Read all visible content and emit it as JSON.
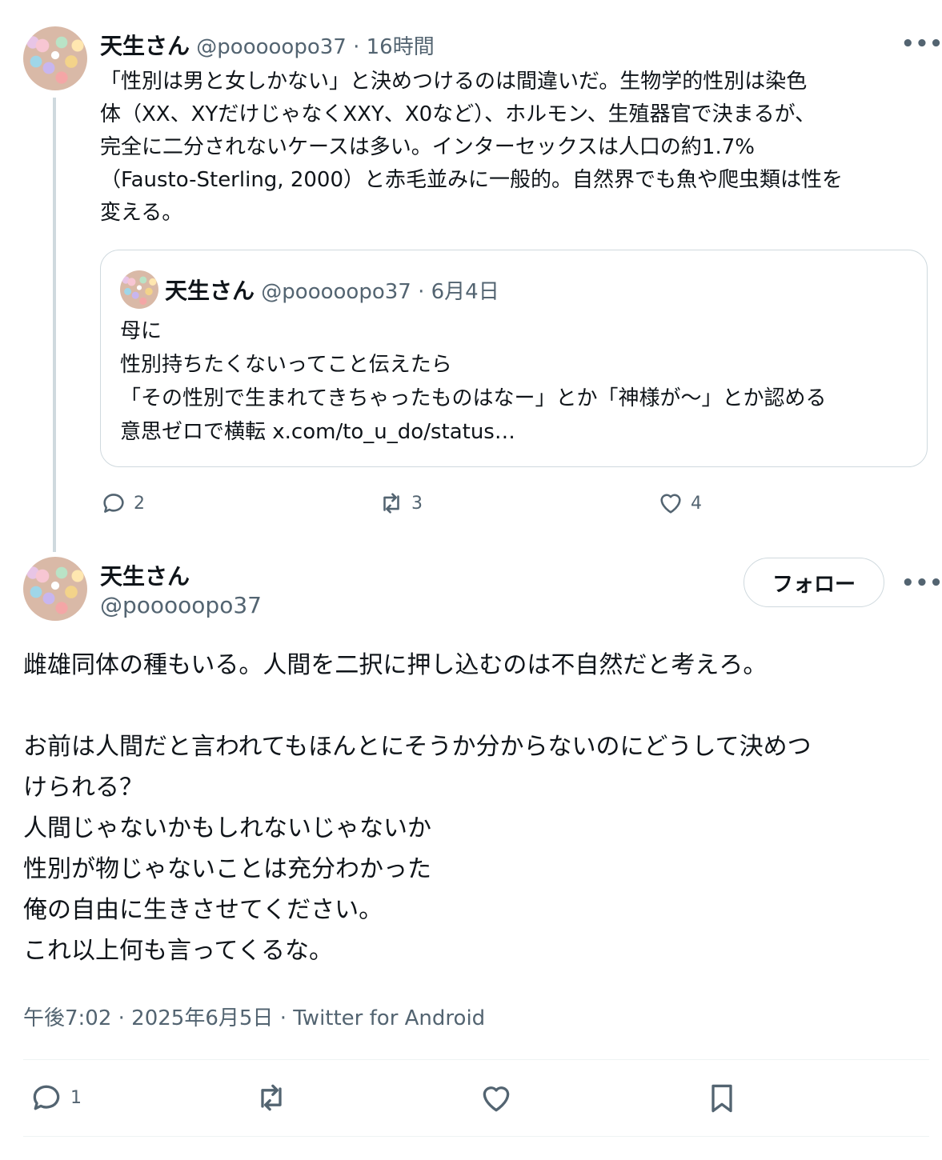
{
  "reply_tweet": {
    "display_name": "天生さん",
    "handle": "@pooooopo37",
    "time": "16時間",
    "more_icon": "more-horizontal-icon",
    "text_lines": [
      "「性別は男と女しかない」と決めつけるのは間違いだ。生物学的性別は染色",
      "体（XX、XYだけじゃなくXXY、X0など）、ホルモン、生殖器官で決まるが、",
      "完全に二分されないケースは多い。インターセックスは人口の約1.7%",
      "（Fausto-Sterling, 2000）と赤毛並みに一般的。自然界でも魚や爬虫類は性を",
      "変える。"
    ],
    "quote": {
      "display_name": "天生さん",
      "handle": "@pooooopo37",
      "date": "6月4日",
      "text_lines": [
        "母に",
        "性別持ちたくないってこと伝えたら",
        "「その性別で生まれてきちゃったものはなー」とか「神様が〜」とか認める",
        "意思ゼロで横転 x.com/to_u_do/status…"
      ]
    },
    "actions": {
      "reply_count": "2",
      "retweet_count": "3",
      "like_count": "4"
    }
  },
  "main_tweet": {
    "display_name": "天生さん",
    "handle": "@pooooopo37",
    "follow_label": "フォロー",
    "text_lines": [
      "雌雄同体の種もいる。人間を二択に押し込むのは不自然だと考えろ。",
      "",
      "お前は人間だと言われてもほんとにそうか分からないのにどうして決めつ",
      "けられる？",
      "人間じゃないかもしれないじゃないか",
      "性別が物じゃないことは充分わかった",
      "俺の自由に生きさせてください。",
      "これ以上何も言ってくるな。"
    ],
    "meta": "午後7:02 · 2025年6月5日 · Twitter for Android",
    "actions": {
      "reply_count": "1"
    }
  }
}
